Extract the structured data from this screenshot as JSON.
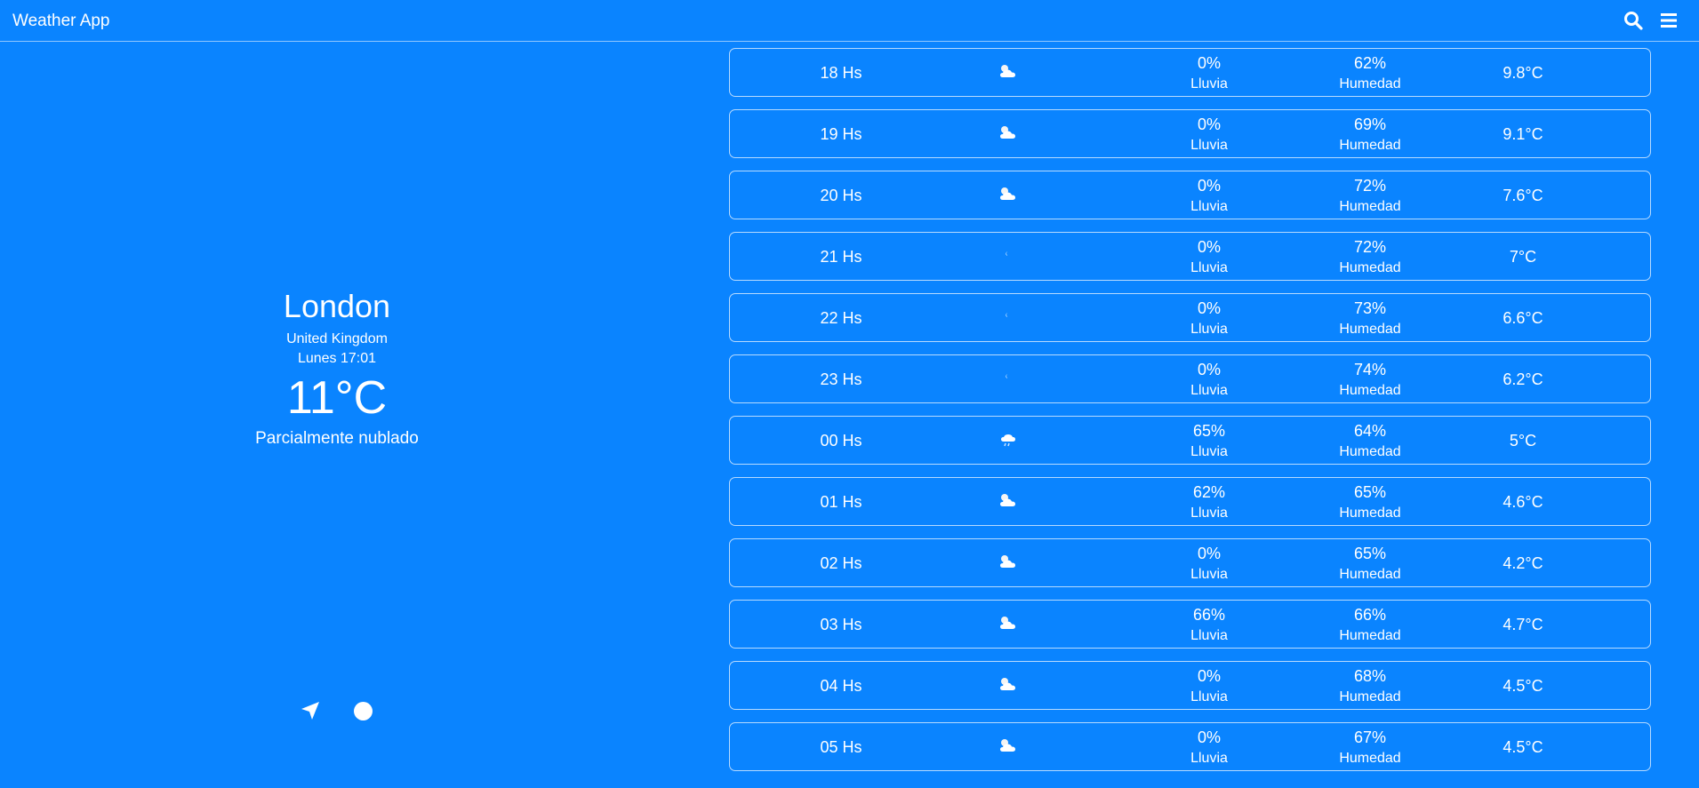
{
  "header": {
    "title": "Weather App",
    "search_icon": "search-icon",
    "menu_icon": "menu-icon"
  },
  "current": {
    "city": "London",
    "country": "United Kingdom",
    "datetime": "Lunes 17:01",
    "temperature": "11°C",
    "condition": "Parcialmente nublado",
    "location_icon": "location-arrow-icon",
    "dot_icon": "circle-icon"
  },
  "forecast": [
    {
      "hour": "18 Hs",
      "icon": "partly-cloudy-icon",
      "rain": "0%",
      "rain_label": "Lluvia",
      "humidity": "62%",
      "humidity_label": "Humedad",
      "temp": "9.8°C"
    },
    {
      "hour": "19 Hs",
      "icon": "partly-cloudy-icon",
      "rain": "0%",
      "rain_label": "Lluvia",
      "humidity": "69%",
      "humidity_label": "Humedad",
      "temp": "9.1°C"
    },
    {
      "hour": "20 Hs",
      "icon": "partly-cloudy-icon",
      "rain": "0%",
      "rain_label": "Lluvia",
      "humidity": "72%",
      "humidity_label": "Humedad",
      "temp": "7.6°C"
    },
    {
      "hour": "21 Hs",
      "icon": "clear-night-icon",
      "rain": "0%",
      "rain_label": "Lluvia",
      "humidity": "72%",
      "humidity_label": "Humedad",
      "temp": "7°C"
    },
    {
      "hour": "22 Hs",
      "icon": "clear-night-icon",
      "rain": "0%",
      "rain_label": "Lluvia",
      "humidity": "73%",
      "humidity_label": "Humedad",
      "temp": "6.6°C"
    },
    {
      "hour": "23 Hs",
      "icon": "clear-night-icon",
      "rain": "0%",
      "rain_label": "Lluvia",
      "humidity": "74%",
      "humidity_label": "Humedad",
      "temp": "6.2°C"
    },
    {
      "hour": "00 Hs",
      "icon": "light-rain-icon",
      "rain": "65%",
      "rain_label": "Lluvia",
      "humidity": "64%",
      "humidity_label": "Humedad",
      "temp": "5°C"
    },
    {
      "hour": "01 Hs",
      "icon": "partly-cloudy-icon",
      "rain": "62%",
      "rain_label": "Lluvia",
      "humidity": "65%",
      "humidity_label": "Humedad",
      "temp": "4.6°C"
    },
    {
      "hour": "02 Hs",
      "icon": "partly-cloudy-icon",
      "rain": "0%",
      "rain_label": "Lluvia",
      "humidity": "65%",
      "humidity_label": "Humedad",
      "temp": "4.2°C"
    },
    {
      "hour": "03 Hs",
      "icon": "partly-cloudy-icon",
      "rain": "66%",
      "rain_label": "Lluvia",
      "humidity": "66%",
      "humidity_label": "Humedad",
      "temp": "4.7°C"
    },
    {
      "hour": "04 Hs",
      "icon": "partly-cloudy-icon",
      "rain": "0%",
      "rain_label": "Lluvia",
      "humidity": "68%",
      "humidity_label": "Humedad",
      "temp": "4.5°C"
    },
    {
      "hour": "05 Hs",
      "icon": "partly-cloudy-icon",
      "rain": "0%",
      "rain_label": "Lluvia",
      "humidity": "67%",
      "humidity_label": "Humedad",
      "temp": "4.5°C"
    }
  ],
  "colors": {
    "background": "#0a84ff",
    "text": "#ffffff"
  }
}
